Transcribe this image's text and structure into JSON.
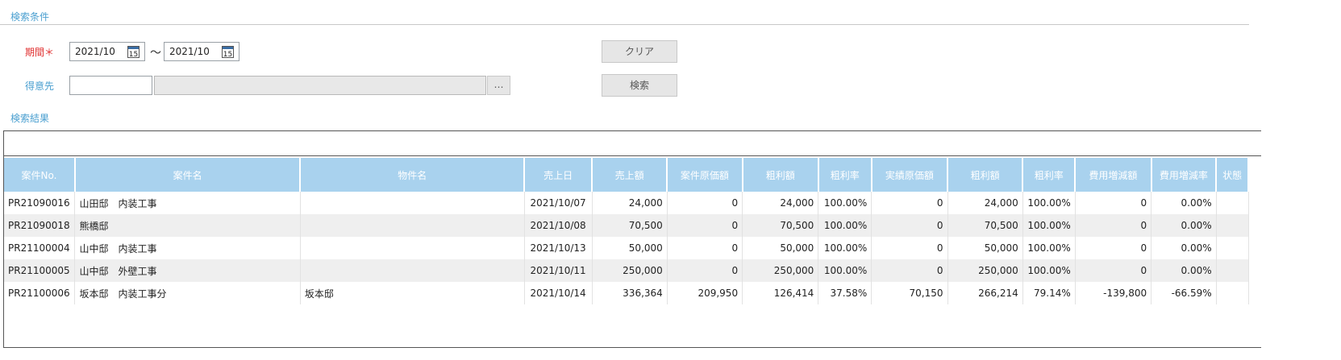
{
  "search": {
    "title": "検索条件",
    "period_label": "期間",
    "required_mark": "＊",
    "date_from": "2021/10",
    "date_to": "2021/10",
    "tilde": "～",
    "cal_day": "15",
    "customer_label": "得意先",
    "customer_code": "",
    "customer_name": "",
    "ellipsis": "…",
    "clear_label": "クリア",
    "search_label": "検索"
  },
  "results": {
    "title": "検索結果",
    "columns": [
      "案件No.",
      "案件名",
      "物件名",
      "売上日",
      "売上額",
      "案件原価額",
      "粗利額",
      "粗利率",
      "実績原価額",
      "粗利額",
      "粗利率",
      "費用増減額",
      "費用増減率",
      "状態"
    ],
    "rows": [
      [
        "PR21090016",
        "山田邸　内装工事",
        "",
        "2021/10/07",
        "24,000",
        "0",
        "24,000",
        "100.00%",
        "0",
        "24,000",
        "100.00%",
        "0",
        "0.00%",
        ""
      ],
      [
        "PR21090018",
        "熊橋邸",
        "",
        "2021/10/08",
        "70,500",
        "0",
        "70,500",
        "100.00%",
        "0",
        "70,500",
        "100.00%",
        "0",
        "0.00%",
        ""
      ],
      [
        "PR21100004",
        "山中邸　内装工事",
        "",
        "2021/10/13",
        "50,000",
        "0",
        "50,000",
        "100.00%",
        "0",
        "50,000",
        "100.00%",
        "0",
        "0.00%",
        ""
      ],
      [
        "PR21100005",
        "山中邸　外壁工事",
        "",
        "2021/10/11",
        "250,000",
        "0",
        "250,000",
        "100.00%",
        "0",
        "250,000",
        "100.00%",
        "0",
        "0.00%",
        ""
      ],
      [
        "PR21100006",
        "坂本邸　内装工事分",
        "坂本邸",
        "2021/10/14",
        "336,364",
        "209,950",
        "126,414",
        "37.58%",
        "70,150",
        "266,214",
        "79.14%",
        "-139,800",
        "-66.59%",
        ""
      ]
    ]
  }
}
